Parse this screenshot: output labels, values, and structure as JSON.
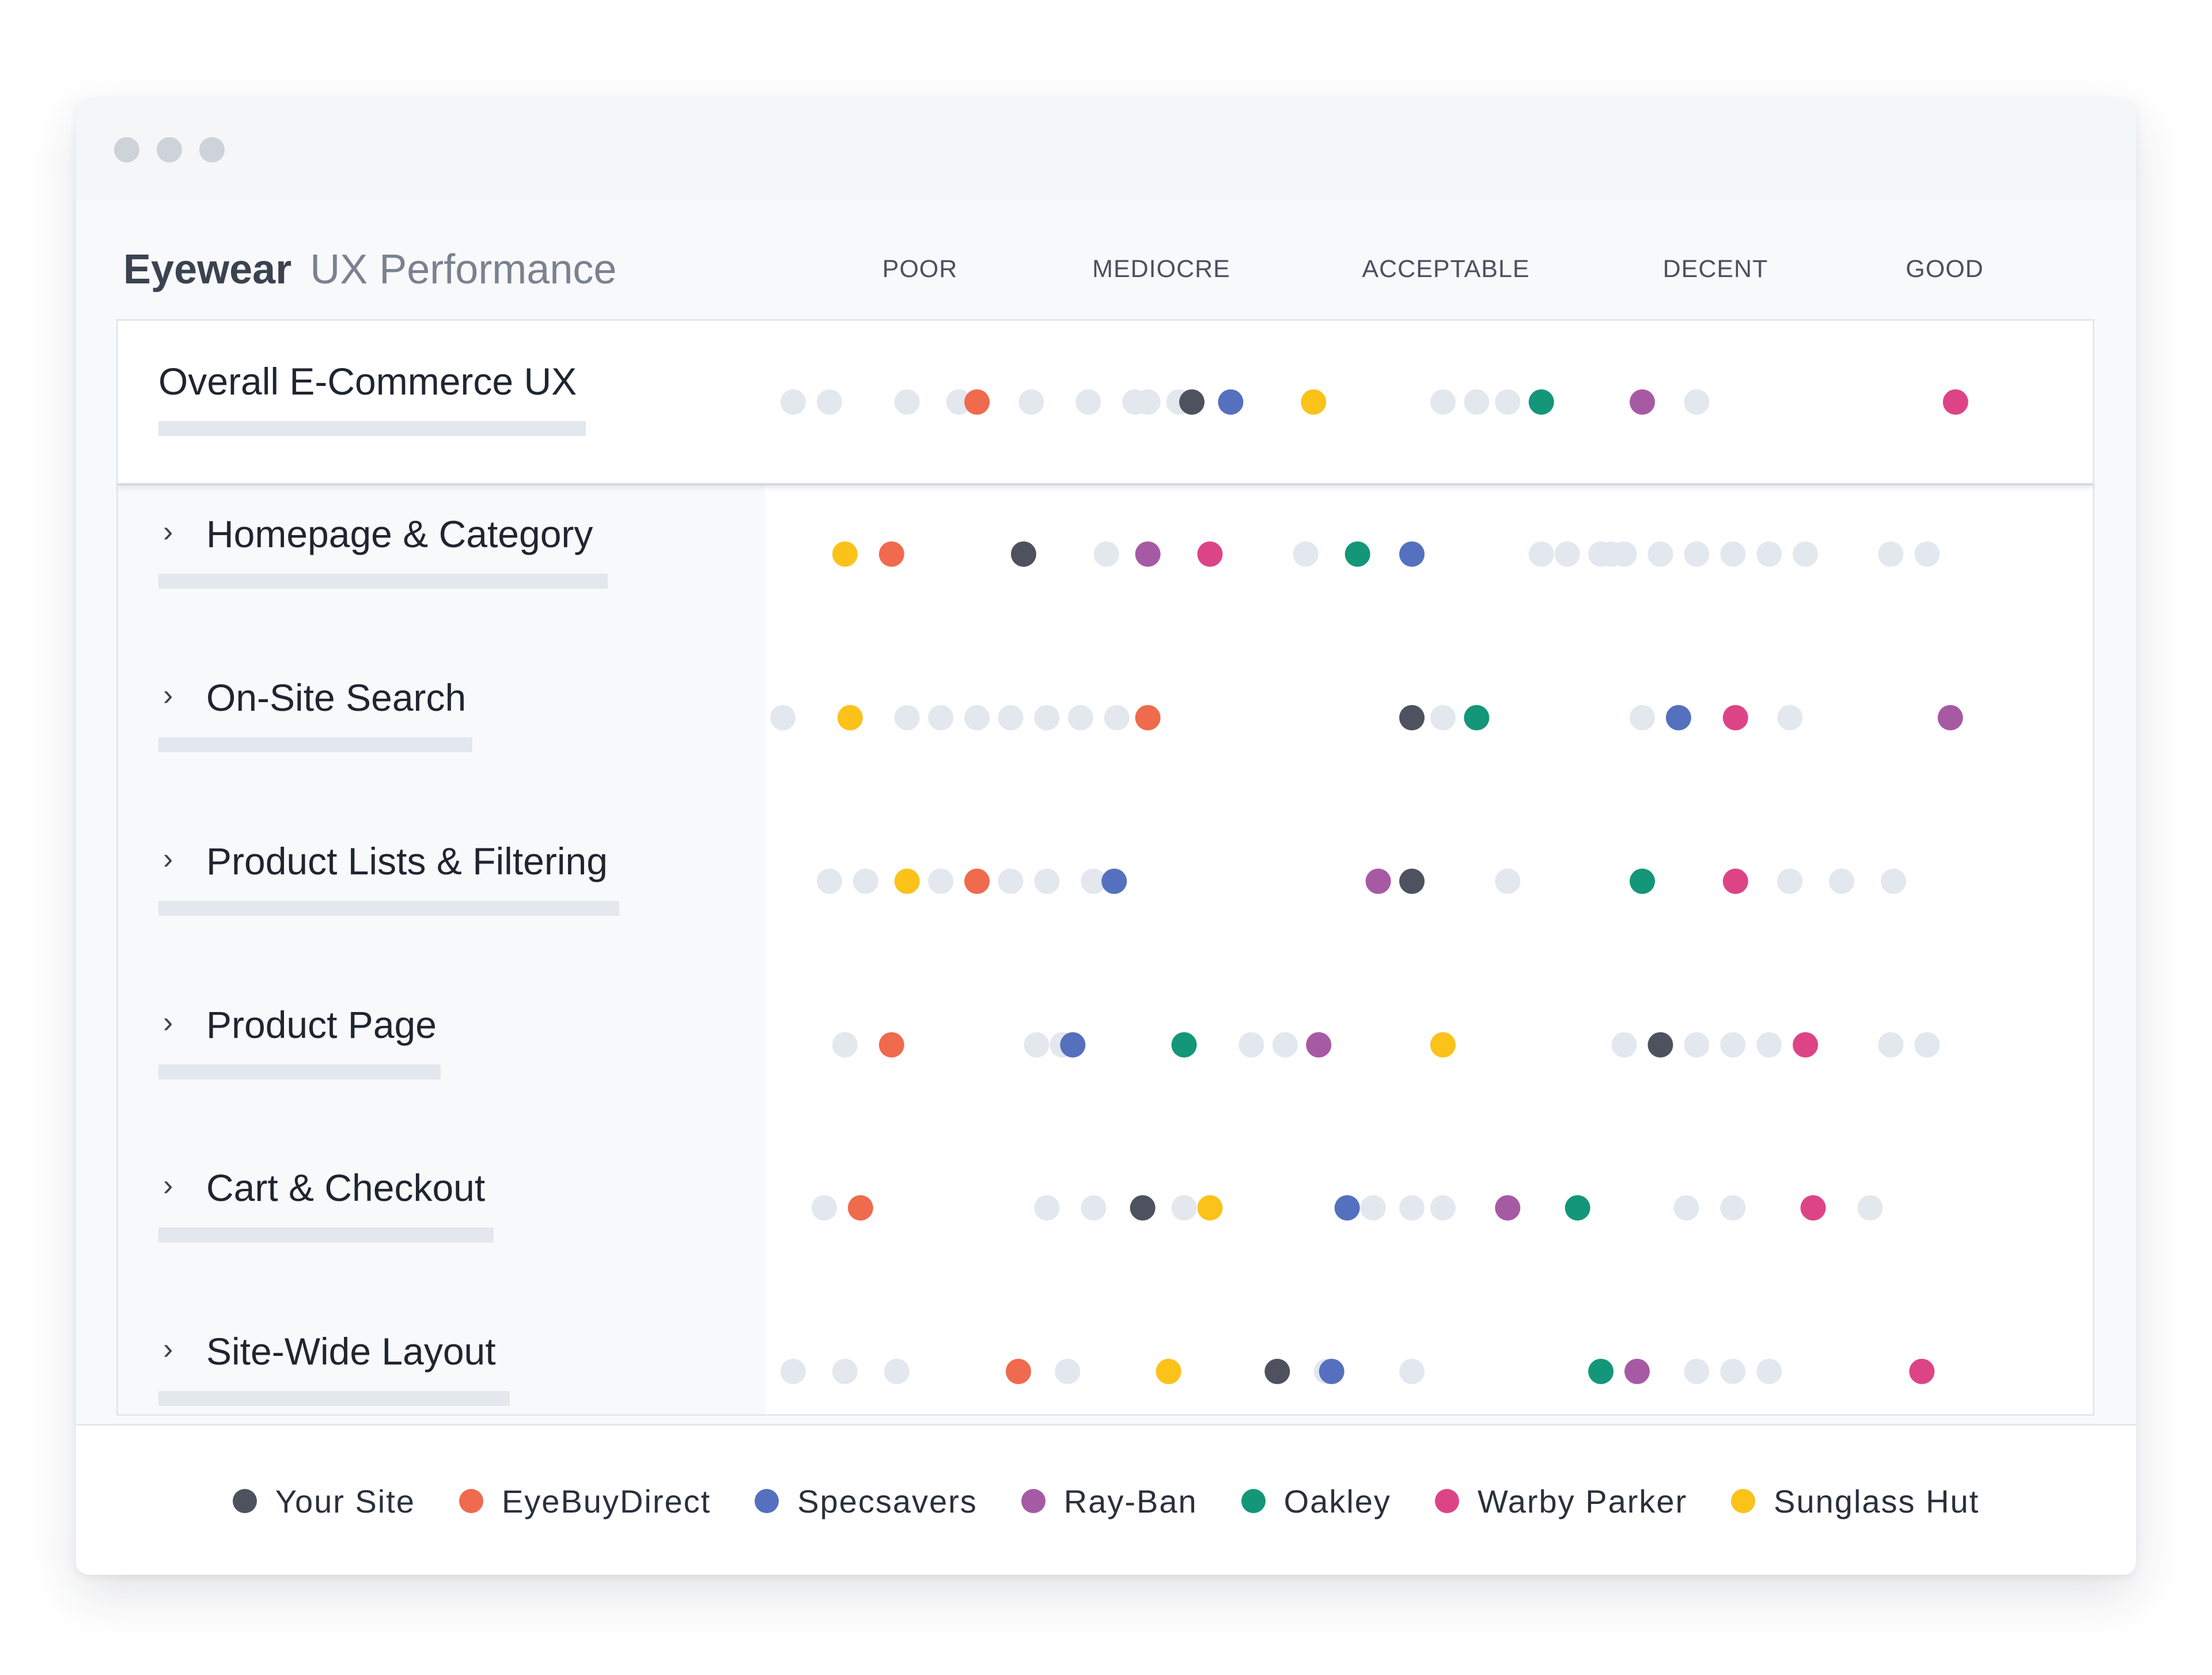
{
  "heading": {
    "brand": "Eyewear",
    "subtitle": "UX Performance"
  },
  "chart_data": {
    "type": "scatter",
    "title": "Eyewear UX Performance",
    "columns": [
      "POOR",
      "MEDIOCRE",
      "ACCEPTABLE",
      "DECENT",
      "GOOD"
    ],
    "rows": [
      {
        "label": "Overall E-Commerce UX",
        "background": [
          0.06,
          0.2,
          0.5,
          0.7,
          0.98,
          1.2,
          1.38,
          1.43,
          1.55,
          2.57,
          2.7,
          2.82,
          3.55,
          4.55
        ],
        "markers": [
          {
            "series": "EyeBuyDirect",
            "value": 0.77
          },
          {
            "series": "Your Site",
            "value": 1.6
          },
          {
            "series": "Specsavers",
            "value": 1.75
          },
          {
            "series": "Sunglass Hut",
            "value": 2.07
          },
          {
            "series": "Oakley",
            "value": 2.95
          },
          {
            "series": "Ray-Ban",
            "value": 3.34
          },
          {
            "series": "Warby Parker",
            "value": 4.55
          }
        ]
      },
      {
        "label": "Homepage & Category",
        "background": [
          1.27,
          2.04,
          2.95,
          3.05,
          3.18,
          3.22,
          3.27,
          3.41,
          3.55,
          3.69,
          3.83,
          3.97,
          4.3,
          4.44
        ],
        "markers": [
          {
            "series": "Sunglass Hut",
            "value": 0.26
          },
          {
            "series": "EyeBuyDirect",
            "value": 0.44
          },
          {
            "series": "Your Site",
            "value": 0.95
          },
          {
            "series": "Ray-Ban",
            "value": 1.43
          },
          {
            "series": "Warby Parker",
            "value": 1.67
          },
          {
            "series": "Oakley",
            "value": 2.24
          },
          {
            "series": "Specsavers",
            "value": 2.45
          }
        ]
      },
      {
        "label": "On-Site Search",
        "background": [
          0.02,
          0.5,
          0.63,
          0.77,
          0.9,
          1.04,
          1.17,
          1.31,
          2.57,
          3.34,
          3.91
        ],
        "markers": [
          {
            "series": "Sunglass Hut",
            "value": 0.28
          },
          {
            "series": "EyeBuyDirect",
            "value": 1.43
          },
          {
            "series": "Your Site",
            "value": 2.45
          },
          {
            "series": "Oakley",
            "value": 2.7
          },
          {
            "series": "Specsavers",
            "value": 3.48
          },
          {
            "series": "Warby Parker",
            "value": 3.7
          },
          {
            "series": "Ray-Ban",
            "value": 4.53
          }
        ]
      },
      {
        "label": "Product Lists & Filtering",
        "background": [
          0.2,
          0.34,
          0.63,
          0.9,
          1.04,
          1.22,
          2.82,
          3.91,
          4.11,
          4.31
        ],
        "markers": [
          {
            "series": "Sunglass Hut",
            "value": 0.5
          },
          {
            "series": "EyeBuyDirect",
            "value": 0.77
          },
          {
            "series": "Specsavers",
            "value": 1.3
          },
          {
            "series": "Ray-Ban",
            "value": 2.32
          },
          {
            "series": "Your Site",
            "value": 2.45
          },
          {
            "series": "Oakley",
            "value": 3.34
          },
          {
            "series": "Warby Parker",
            "value": 3.7
          }
        ]
      },
      {
        "label": "Product Page",
        "background": [
          0.26,
          1.0,
          1.1,
          1.83,
          1.96,
          3.27,
          3.55,
          3.69,
          3.83,
          4.3,
          4.44
        ],
        "markers": [
          {
            "series": "EyeBuyDirect",
            "value": 0.44
          },
          {
            "series": "Specsavers",
            "value": 1.14
          },
          {
            "series": "Oakley",
            "value": 1.57
          },
          {
            "series": "Ray-Ban",
            "value": 2.09
          },
          {
            "series": "Sunglass Hut",
            "value": 2.57
          },
          {
            "series": "Your Site",
            "value": 3.41
          },
          {
            "series": "Warby Parker",
            "value": 3.97
          }
        ]
      },
      {
        "label": "Cart & Checkout",
        "background": [
          0.18,
          1.04,
          1.22,
          1.57,
          2.3,
          2.45,
          2.57,
          3.51,
          3.69,
          4.22
        ],
        "markers": [
          {
            "series": "EyeBuyDirect",
            "value": 0.32
          },
          {
            "series": "Your Site",
            "value": 1.41
          },
          {
            "series": "Sunglass Hut",
            "value": 1.67
          },
          {
            "series": "Specsavers",
            "value": 2.2
          },
          {
            "series": "Ray-Ban",
            "value": 2.82
          },
          {
            "series": "Oakley",
            "value": 3.09
          },
          {
            "series": "Warby Parker",
            "value": 4.0
          }
        ]
      },
      {
        "label": "Site-Wide Layout",
        "background": [
          0.06,
          0.26,
          0.46,
          1.12,
          2.12,
          2.45,
          3.55,
          3.69,
          3.83
        ],
        "markers": [
          {
            "series": "EyeBuyDirect",
            "value": 0.93
          },
          {
            "series": "Sunglass Hut",
            "value": 1.51
          },
          {
            "series": "Your Site",
            "value": 1.93
          },
          {
            "series": "Specsavers",
            "value": 2.14
          },
          {
            "series": "Oakley",
            "value": 3.18
          },
          {
            "series": "Ray-Ban",
            "value": 3.32
          },
          {
            "series": "Warby Parker",
            "value": 4.42
          }
        ]
      }
    ],
    "series": [
      {
        "name": "Your Site",
        "color": "#4d525e"
      },
      {
        "name": "EyeBuyDirect",
        "color": "#f06a4d"
      },
      {
        "name": "Specsavers",
        "color": "#5470bf"
      },
      {
        "name": "Ray-Ban",
        "color": "#a75aa4"
      },
      {
        "name": "Oakley",
        "color": "#149679"
      },
      {
        "name": "Warby Parker",
        "color": "#dd4486"
      },
      {
        "name": "Sunglass Hut",
        "color": "#fbc21a"
      }
    ],
    "background_color": "#e3e7ee",
    "xlim": [
      0,
      5
    ],
    "grid": false,
    "legend": "bottom"
  }
}
